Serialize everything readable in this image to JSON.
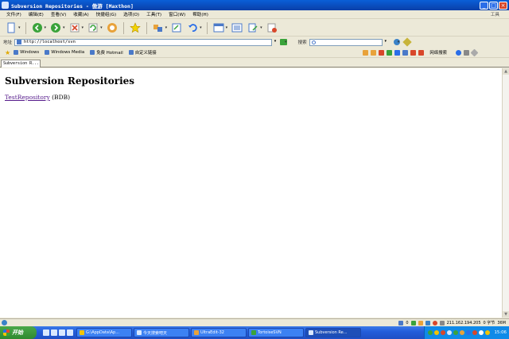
{
  "window": {
    "title": "Subversion Repositories - 傲游 [Maxthon]"
  },
  "menu": {
    "items": [
      "文件(F)",
      "编辑(E)",
      "查看(V)",
      "收藏(A)",
      "快捷组(G)",
      "选项(O)",
      "工具(T)",
      "窗口(W)",
      "帮助(H)"
    ],
    "tools_label": "工具"
  },
  "address": {
    "label": "地址",
    "url": "http://localhost/svn"
  },
  "search": {
    "label": "搜索"
  },
  "links": {
    "items": [
      "Windows",
      "Windows Media",
      "免费 Hotmail",
      "自定义链接"
    ],
    "assistant": "网络搜索"
  },
  "tab": {
    "label": "Subversion R..."
  },
  "content": {
    "heading": "Subversion Repositories",
    "repo_link": "TestRepository",
    "repo_type": "(BDB)"
  },
  "status": {
    "count": "0",
    "ip": "211.162.194.205",
    "bytes": "0 字节",
    "memory": "36M"
  },
  "taskbar": {
    "start_label": "开始",
    "tasks": [
      "G:\\AppData\\Ap...",
      "今天搜索吧天",
      "UltraEdit-32",
      "TortoiseSVN",
      "Subversion Re..."
    ],
    "clock": "15:06"
  }
}
